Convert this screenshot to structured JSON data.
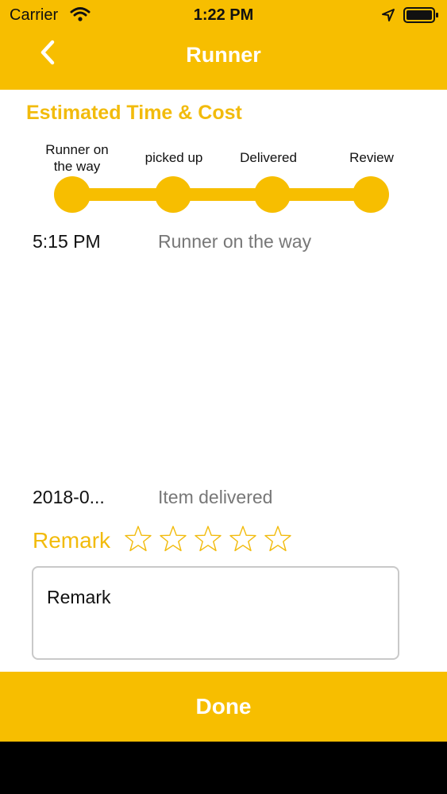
{
  "status_bar": {
    "carrier": "Carrier",
    "time": "1:22 PM"
  },
  "nav": {
    "title": "Runner",
    "back_icon": "chevron-left-icon"
  },
  "section_title": "Estimated Time & Cost",
  "steps": [
    {
      "label": "Runner on the way"
    },
    {
      "label": "picked up"
    },
    {
      "label": "Delivered"
    },
    {
      "label": "Review"
    }
  ],
  "events": [
    {
      "time": "5:15 PM",
      "text": "Runner on the way"
    },
    {
      "time": "2018-0...",
      "text": "Item delivered"
    }
  ],
  "rating": {
    "label": "Remark",
    "value": 0,
    "max": 5
  },
  "remark_input": {
    "placeholder": "Remark"
  },
  "done_label": "Done",
  "colors": {
    "accent": "#f7be00",
    "accent_text": "#f2bb0c",
    "muted_text": "#777777"
  }
}
